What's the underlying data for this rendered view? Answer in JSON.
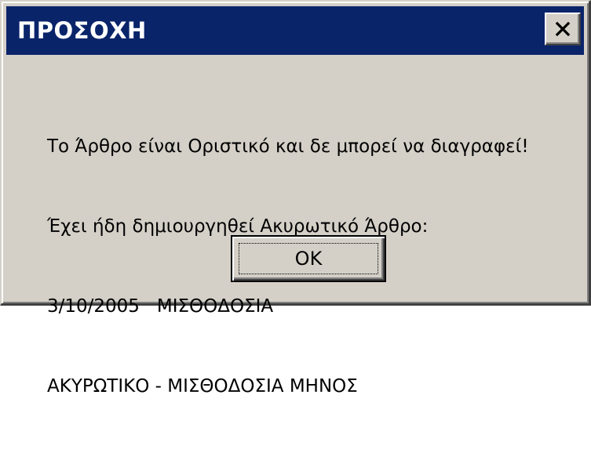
{
  "window": {
    "title": "ΠΡΟΣΟΧΗ",
    "title_bar_color": "#0a246a",
    "background_color": "#d4d0c8",
    "close_icon": "close-icon"
  },
  "message": {
    "lines": [
      "Το Άρθρο είναι Οριστικό και δε μπορεί να διαγραφεί!",
      "Έχει ήδη δημιουργηθεί Ακυρωτικό Άρθρο:",
      "3/10/2005   ΜΙΣΘΟΔΟΣΙΑ",
      "ΑΚΥΡΩΤΙΚΟ - ΜΙΣΘΟΔΟΣΙΑ ΜΗΝΟΣ"
    ]
  },
  "buttons": {
    "ok_label": "OK"
  }
}
